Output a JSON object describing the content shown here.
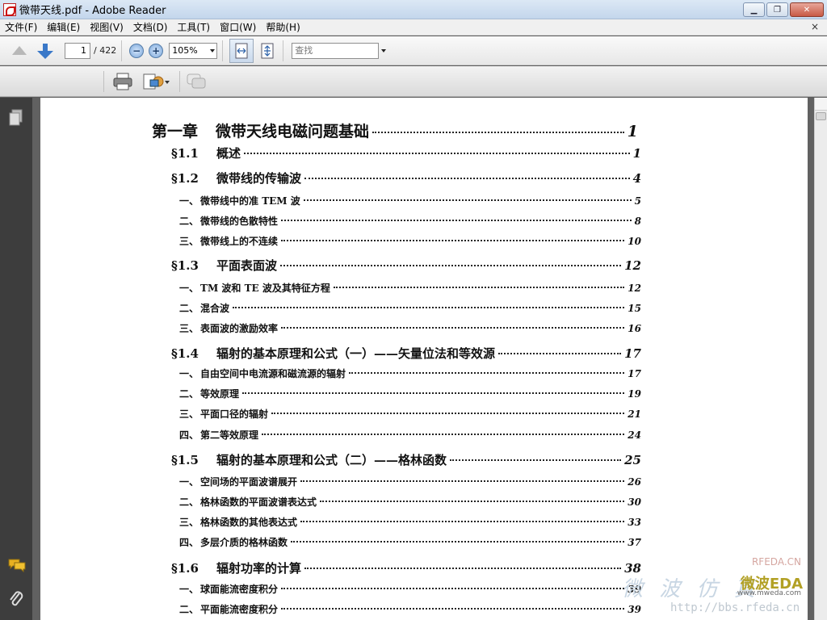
{
  "window": {
    "title": "微带天线.pdf - Adobe Reader",
    "minimize": "▁",
    "maximize": "❐",
    "close": "✕"
  },
  "menu": [
    "文件(F)",
    "编辑(E)",
    "视图(V)",
    "文档(D)",
    "工具(T)",
    "窗口(W)",
    "帮助(H)"
  ],
  "menu_close": "×",
  "toolbar": {
    "page_current": "1",
    "page_total": "/ 422",
    "zoom": "105%",
    "find_placeholder": "查找"
  },
  "toc": {
    "chapter": {
      "num": "第一章",
      "label": "微带天线电磁问题基础",
      "page": "1"
    },
    "entries": [
      {
        "kind": "section",
        "num": "§1.1",
        "label": "概述",
        "page": "1"
      },
      {
        "kind": "section",
        "num": "§1.2",
        "label": "微带线的传输波",
        "page": "4"
      },
      {
        "kind": "sub",
        "num": "一、",
        "label": "微带线中的准 TEM 波",
        "page": "5"
      },
      {
        "kind": "sub",
        "num": "二、",
        "label": "微带线的色散特性",
        "page": "8"
      },
      {
        "kind": "sub",
        "num": "三、",
        "label": "微带线上的不连续",
        "page": "10"
      },
      {
        "kind": "section",
        "num": "§1.3",
        "label": "平面表面波",
        "page": "12"
      },
      {
        "kind": "sub",
        "num": "一、",
        "label": "TM 波和 TE 波及其特征方程",
        "page": "12"
      },
      {
        "kind": "sub",
        "num": "二、",
        "label": "混合波",
        "page": "15"
      },
      {
        "kind": "sub",
        "num": "三、",
        "label": "表面波的激励效率",
        "page": "16"
      },
      {
        "kind": "section",
        "num": "§1.4",
        "label": "辐射的基本原理和公式（一）——矢量位法和等效源",
        "page": "17"
      },
      {
        "kind": "sub",
        "num": "一、",
        "label": "自由空间中电流源和磁流源的辐射",
        "page": "17"
      },
      {
        "kind": "sub",
        "num": "二、",
        "label": "等效原理",
        "page": "19"
      },
      {
        "kind": "sub",
        "num": "三、",
        "label": "平面口径的辐射",
        "page": "21"
      },
      {
        "kind": "sub",
        "num": "四、",
        "label": "第二等效原理",
        "page": "24"
      },
      {
        "kind": "section",
        "num": "§1.5",
        "label": "辐射的基本原理和公式（二）——格林函数",
        "page": "25"
      },
      {
        "kind": "sub",
        "num": "一、",
        "label": "空间场的平面波谱展开",
        "page": "26"
      },
      {
        "kind": "sub",
        "num": "二、",
        "label": "格林函数的平面波谱表达式",
        "page": "30"
      },
      {
        "kind": "sub",
        "num": "三、",
        "label": "格林函数的其他表达式",
        "page": "33"
      },
      {
        "kind": "sub",
        "num": "四、",
        "label": "多层介质的格林函数",
        "page": "37"
      },
      {
        "kind": "section",
        "num": "§1.6",
        "label": "辐射功率的计算",
        "page": "38"
      },
      {
        "kind": "sub",
        "num": "一、",
        "label": "球面能流密度积分",
        "page": "39"
      },
      {
        "kind": "sub",
        "num": "二、",
        "label": "平面能流密度积分",
        "page": "39"
      }
    ]
  },
  "watermark": {
    "site_label": "RFEDA.CN",
    "brand": "微波EDA",
    "cn_text": "微 波 仿 真",
    "url": "http://bbs.rfeda.cn",
    "www": "www.mweda.com"
  },
  "colors": {
    "nav_bg": "#3d3d3d",
    "doc_bg": "#616161",
    "accent": "#3a78c8"
  }
}
